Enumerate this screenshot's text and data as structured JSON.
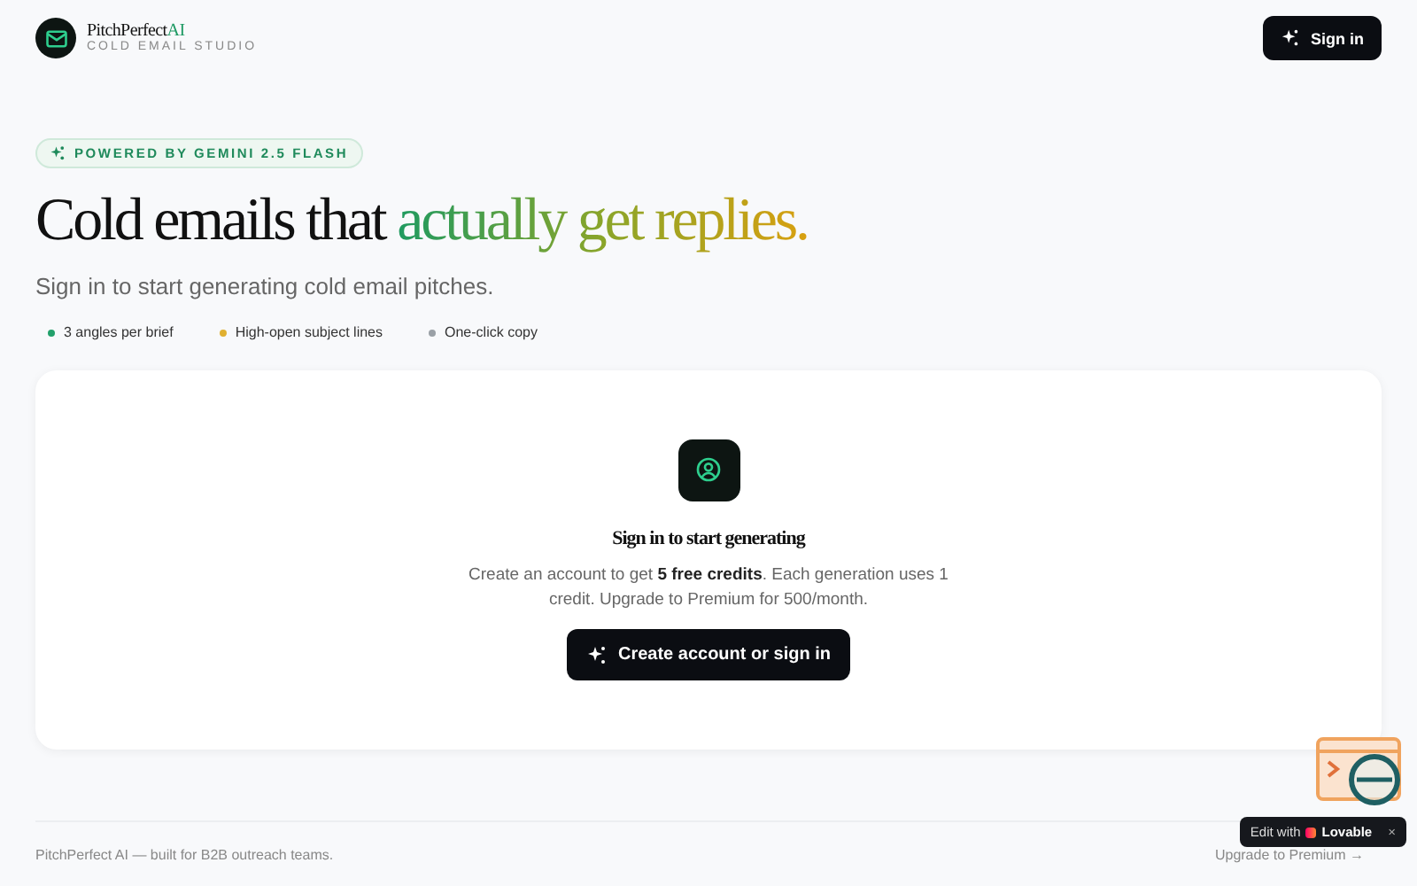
{
  "header": {
    "brand": {
      "name": "PitchPerfect",
      "accent": "AI",
      "tagline": "COLD EMAIL STUDIO"
    },
    "sign_in_button": "Sign in"
  },
  "hero": {
    "badge": "POWERED BY GEMINI 2.5 FLASH",
    "title": "Cold emails that",
    "title_highlight": "actually get replies.",
    "subtitle": "Sign in to start generating cold email pitches.",
    "features": [
      {
        "label": "3 angles per brief",
        "color": "#22a06b"
      },
      {
        "label": "High-open subject lines",
        "color": "#e0b030"
      },
      {
        "label": "One-click copy",
        "color": "#9aa0a6"
      }
    ]
  },
  "card": {
    "title": "Sign in to start generating",
    "text": "Create an account to get **5 free credits**. Each generation uses 1 credit. Upgrade to Premium for 500/month.",
    "button": "Create account or sign in"
  },
  "footer": {
    "text": "PitchPerfect AI — built for B2B outreach teams.",
    "link": "Upgrade to Premium →"
  },
  "edit_badge": {
    "prefix": "Edit with",
    "brand": "Lovable",
    "close": "×"
  }
}
